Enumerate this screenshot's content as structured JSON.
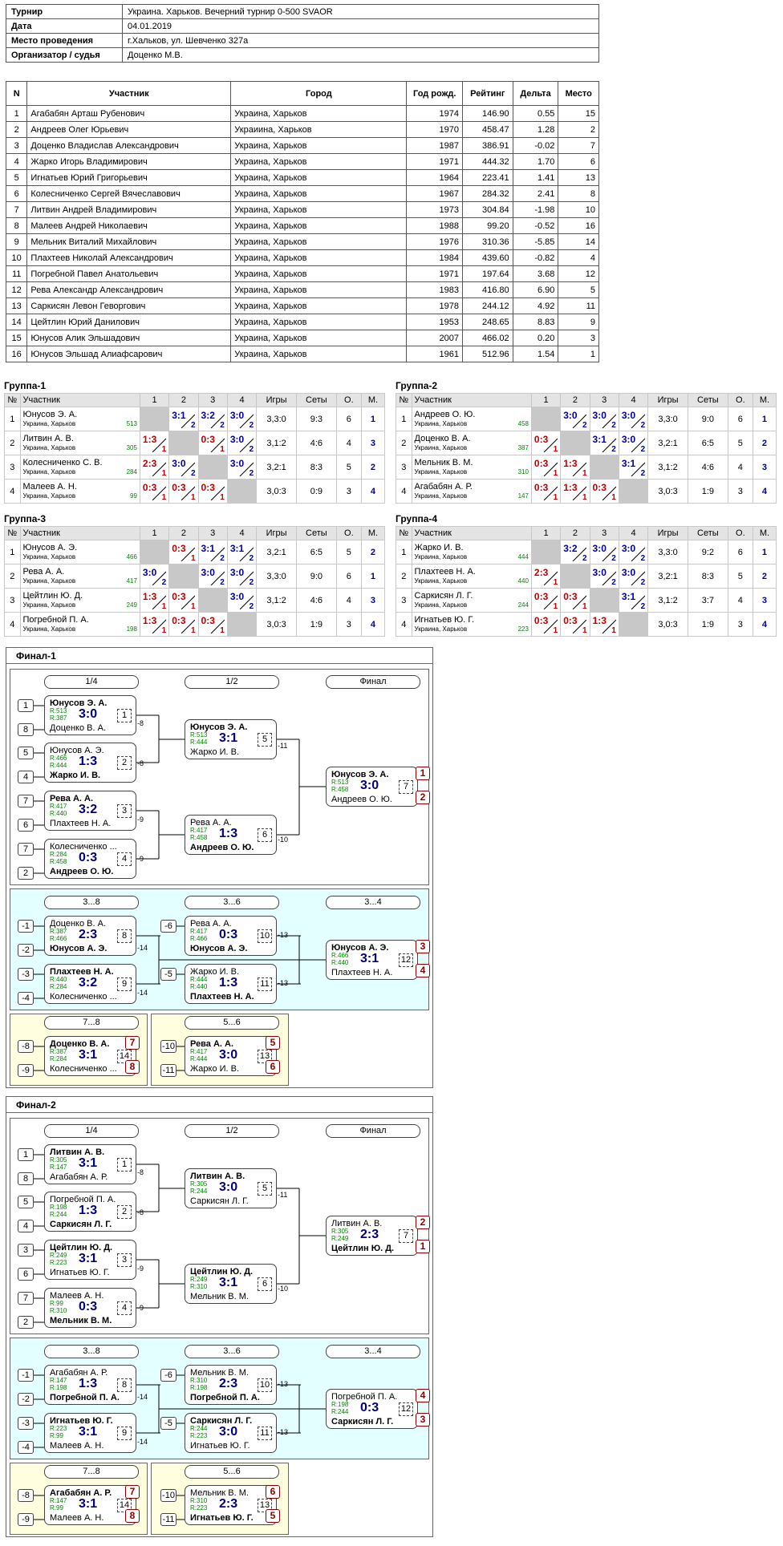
{
  "info": {
    "rows": [
      {
        "k": "Турнир",
        "v": "Украина. Харьков. Вечерний турнир 0-500 SVAOR"
      },
      {
        "k": "Дата",
        "v": "04.01.2019"
      },
      {
        "k": "Место проведения",
        "v": "г.Хальков, ул. Шевченко 327а"
      },
      {
        "k": "Организатор / судья",
        "v": "Доценко М.В."
      }
    ]
  },
  "participants": {
    "headers": [
      "N",
      "Участник",
      "Город",
      "Год рожд.",
      "Рейтинг",
      "Дельта",
      "Место"
    ],
    "rows": [
      [
        "1",
        "Агабабян Арташ Рубенович",
        "Украина, Харьков",
        "1974",
        "146.90",
        "0.55",
        "15"
      ],
      [
        "2",
        "Андреев Олег Юрьевич",
        "Украиина, Харьков",
        "1970",
        "458.47",
        "1.28",
        "2"
      ],
      [
        "3",
        "Доценко Владислав Александрович",
        "Украина, Харьков",
        "1987",
        "386.91",
        "-0.02",
        "7"
      ],
      [
        "4",
        "Жарко Игорь Владимирович",
        "Украина, Харьков",
        "1971",
        "444.32",
        "1.70",
        "6"
      ],
      [
        "5",
        "Игнатьев Юрий Григорьевич",
        "Украина, Харьков",
        "1964",
        "223.41",
        "1.41",
        "13"
      ],
      [
        "6",
        "Колесниченко Сергей Вячеславович",
        "Украина, Харьков",
        "1967",
        "284.32",
        "2.41",
        "8"
      ],
      [
        "7",
        "Литвин Андрей Владимирович",
        "Украина, Харьков",
        "1973",
        "304.84",
        "-1.98",
        "10"
      ],
      [
        "8",
        "Малеев Андрей Николаевич",
        "Украина, Харьков",
        "1988",
        "99.20",
        "-0.52",
        "16"
      ],
      [
        "9",
        "Мельник Виталий Михайлович",
        "Украина, Харьков",
        "1976",
        "310.36",
        "-5.85",
        "14"
      ],
      [
        "10",
        "Плахтеев Николай Александрович",
        "Украина, Харьков",
        "1984",
        "439.60",
        "-0.82",
        "4"
      ],
      [
        "11",
        "Погребной Павел Анатольевич",
        "Украина, Харьков",
        "1971",
        "197.64",
        "3.68",
        "12"
      ],
      [
        "12",
        "Рева Александр Александрович",
        "Украина, Харьков",
        "1983",
        "416.80",
        "6.90",
        "5"
      ],
      [
        "13",
        "Саркисян Левон Геворгович",
        "Украина, Харьков",
        "1978",
        "244.12",
        "4.92",
        "11"
      ],
      [
        "14",
        "Цейтлин Юрий Данилович",
        "Украина, Харьков",
        "1953",
        "248.65",
        "8.83",
        "9"
      ],
      [
        "15",
        "Юнусов Алик Эльшадович",
        "Украина, Харьков",
        "2007",
        "466.02",
        "0.20",
        "3"
      ],
      [
        "16",
        "Юнусов Эльшад Алиафсарович",
        "Украина, Харьков",
        "1961",
        "512.96",
        "1.54",
        "1"
      ]
    ]
  },
  "groups": [
    {
      "title": "Группа-1",
      "headers": [
        "№",
        "Участник",
        "1",
        "2",
        "3",
        "4",
        "Игры",
        "Сеты",
        "О.",
        "М."
      ],
      "rows": [
        {
          "n": "1",
          "name": "Юнусов Э. А.",
          "city": "Украина, Харьков",
          "rating": "513",
          "cells": [
            "",
            "3:1|2",
            "3:2|2",
            "3:0|2"
          ],
          "games": "3,3:0",
          "sets": "9:3",
          "pts": "6",
          "place": "1"
        },
        {
          "n": "2",
          "name": "Литвин А. В.",
          "city": "Украина, Харьков",
          "rating": "305",
          "cells": [
            "1:3|1",
            "",
            "0:3|1",
            "3:0|2"
          ],
          "games": "3,1:2",
          "sets": "4:6",
          "pts": "4",
          "place": "3"
        },
        {
          "n": "3",
          "name": "Колесниченко С. В.",
          "city": "Украина, Харьков",
          "rating": "284",
          "cells": [
            "2:3|1",
            "3:0|2",
            "",
            "3:0|2"
          ],
          "games": "3,2:1",
          "sets": "8:3",
          "pts": "5",
          "place": "2"
        },
        {
          "n": "4",
          "name": "Малеев А. Н.",
          "city": "Украина, Харьков",
          "rating": "99",
          "cells": [
            "0:3|1",
            "0:3|1",
            "0:3|1",
            ""
          ],
          "games": "3,0:3",
          "sets": "0:9",
          "pts": "3",
          "place": "4"
        }
      ]
    },
    {
      "title": "Группа-2",
      "headers": [
        "№",
        "Участник",
        "1",
        "2",
        "3",
        "4",
        "Игры",
        "Сеты",
        "О.",
        "М."
      ],
      "rows": [
        {
          "n": "1",
          "name": "Андреев О. Ю.",
          "city": "Украина, Харьков",
          "rating": "458",
          "cells": [
            "",
            "3:0|2",
            "3:0|2",
            "3:0|2"
          ],
          "games": "3,3:0",
          "sets": "9:0",
          "pts": "6",
          "place": "1"
        },
        {
          "n": "2",
          "name": "Доценко В. А.",
          "city": "Украина, Харьков",
          "rating": "387",
          "cells": [
            "0:3|1",
            "",
            "3:1|2",
            "3:0|2"
          ],
          "games": "3,2:1",
          "sets": "6:5",
          "pts": "5",
          "place": "2"
        },
        {
          "n": "3",
          "name": "Мельник В. М.",
          "city": "Украина, Харьков",
          "rating": "310",
          "cells": [
            "0:3|1",
            "1:3|1",
            "",
            "3:1|2"
          ],
          "games": "3,1:2",
          "sets": "4:6",
          "pts": "4",
          "place": "3"
        },
        {
          "n": "4",
          "name": "Агабабян А. Р.",
          "city": "Украина, Харьков",
          "rating": "147",
          "cells": [
            "0:3|1",
            "1:3|1",
            "0:3|1",
            ""
          ],
          "games": "3,0:3",
          "sets": "1:9",
          "pts": "3",
          "place": "4"
        }
      ]
    },
    {
      "title": "Группа-3",
      "headers": [
        "№",
        "Участник",
        "1",
        "2",
        "3",
        "4",
        "Игры",
        "Сеты",
        "О.",
        "М."
      ],
      "rows": [
        {
          "n": "1",
          "name": "Юнусов А. Э.",
          "city": "Украина, Харьков",
          "rating": "466",
          "cells": [
            "",
            "0:3|1",
            "3:1|2",
            "3:1|2"
          ],
          "games": "3,2:1",
          "sets": "6:5",
          "pts": "5",
          "place": "2"
        },
        {
          "n": "2",
          "name": "Рева А. А.",
          "city": "Украина, Харьков",
          "rating": "417",
          "cells": [
            "3:0|2",
            "",
            "3:0|2",
            "3:0|2"
          ],
          "games": "3,3:0",
          "sets": "9:0",
          "pts": "6",
          "place": "1"
        },
        {
          "n": "3",
          "name": "Цейтлин Ю. Д.",
          "city": "Украина, Харьков",
          "rating": "249",
          "cells": [
            "1:3|1",
            "0:3|1",
            "",
            "3:0|2"
          ],
          "games": "3,1:2",
          "sets": "4:6",
          "pts": "4",
          "place": "3"
        },
        {
          "n": "4",
          "name": "Погребной П. А.",
          "city": "Украина, Харьков",
          "rating": "198",
          "cells": [
            "1:3|1",
            "0:3|1",
            "0:3|1",
            ""
          ],
          "games": "3,0:3",
          "sets": "1:9",
          "pts": "3",
          "place": "4"
        }
      ]
    },
    {
      "title": "Группа-4",
      "headers": [
        "№",
        "Участник",
        "1",
        "2",
        "3",
        "4",
        "Игры",
        "Сеты",
        "О.",
        "М."
      ],
      "rows": [
        {
          "n": "1",
          "name": "Жарко И. В.",
          "city": "Украина, Харьков",
          "rating": "444",
          "cells": [
            "",
            "3:2|2",
            "3:0|2",
            "3:0|2"
          ],
          "games": "3,3:0",
          "sets": "9:2",
          "pts": "6",
          "place": "1"
        },
        {
          "n": "2",
          "name": "Плахтеев Н. А.",
          "city": "Украина, Харьков",
          "rating": "440",
          "cells": [
            "2:3|1",
            "",
            "3:0|2",
            "3:0|2"
          ],
          "games": "3,2:1",
          "sets": "8:3",
          "pts": "5",
          "place": "2"
        },
        {
          "n": "3",
          "name": "Саркисян Л. Г.",
          "city": "Украина, Харьков",
          "rating": "244",
          "cells": [
            "0:3|1",
            "0:3|1",
            "",
            "3:1|2"
          ],
          "games": "3,1:2",
          "sets": "3:7",
          "pts": "4",
          "place": "3"
        },
        {
          "n": "4",
          "name": "Игнатьев Ю. Г.",
          "city": "Украина, Харьков",
          "rating": "223",
          "cells": [
            "0:3|1",
            "0:3|1",
            "1:3|1",
            ""
          ],
          "games": "3,0:3",
          "sets": "1:9",
          "pts": "3",
          "place": "4"
        }
      ]
    }
  ],
  "finals": [
    {
      "title": "Финал-1",
      "rounds": [
        "1/4",
        "1/2",
        "Финал",
        "3...8",
        "3...6",
        "3...4",
        "7...8",
        "5...6"
      ],
      "matches": [
        {
          "p1": "Юнусов Э. А.",
          "r1": "R:513",
          "p2": "Доценко В. А.",
          "r2": "R:387",
          "score": "3:0",
          "no": "1",
          "win": 1,
          "lose": "-8"
        },
        {
          "p1": "Юнусов А. Э.",
          "r1": "R:466",
          "p2": "Жарко И. В.",
          "r2": "R:444",
          "score": "1:3",
          "no": "2",
          "win": 2,
          "lose": "-8"
        },
        {
          "p1": "Рева А. А.",
          "r1": "R:417",
          "p2": "Плахтеев Н. А.",
          "r2": "R:440",
          "score": "3:2",
          "no": "3",
          "win": 1,
          "lose": "-9"
        },
        {
          "p1": "Колесниченко ...",
          "r1": "R:284",
          "p2": "Андреев О. Ю.",
          "r2": "R:458",
          "score": "0:3",
          "no": "4",
          "win": 2,
          "lose": "-9"
        },
        {
          "p1": "Юнусов Э. А.",
          "r1": "R:513",
          "p2": "Жарко И. В.",
          "r2": "R:444",
          "score": "3:1",
          "no": "5",
          "win": 1,
          "lose": "-11"
        },
        {
          "p1": "Рева А. А.",
          "r1": "R:417",
          "p2": "Андреев О. Ю.",
          "r2": "R:458",
          "score": "1:3",
          "no": "6",
          "win": 2,
          "lose": "-10"
        },
        {
          "p1": "Юнусов Э. А.",
          "r1": "R:513",
          "p2": "Андреев О. Ю.",
          "r2": "R:458",
          "score": "3:0",
          "no": "7",
          "win": 1,
          "lose": ""
        },
        {
          "p1": "Доценко В. А.",
          "r1": "R:387",
          "p2": "Юнусов А. Э.",
          "r2": "R:466",
          "score": "2:3",
          "no": "8",
          "win": 2,
          "lose": "-14"
        },
        {
          "p1": "Плахтеев Н. А.",
          "r1": "R:440",
          "p2": "Колесниченко ...",
          "r2": "R:284",
          "score": "3:2",
          "no": "9",
          "win": 1,
          "lose": "-14"
        },
        {
          "p1": "Рева А. А.",
          "r1": "R:417",
          "p2": "Юнусов А. Э.",
          "r2": "R:466",
          "score": "0:3",
          "no": "10",
          "win": 2,
          "lose": "-13"
        },
        {
          "p1": "Жарко И. В.",
          "r1": "R:444",
          "p2": "Плахтеев Н. А.",
          "r2": "R:440",
          "score": "1:3",
          "no": "11",
          "win": 2,
          "lose": "-13"
        },
        {
          "p1": "Юнусов А. Э.",
          "r1": "R:466",
          "p2": "Плахтеев Н. А.",
          "r2": "R:440",
          "score": "3:1",
          "no": "12",
          "win": 1,
          "lose": ""
        },
        {
          "p1": "Доценко В. А.",
          "r1": "R:387",
          "p2": "Колесниченко ...",
          "r2": "R:284",
          "score": "3:1",
          "no": "14",
          "win": 1,
          "lose": ""
        },
        {
          "p1": "Рева А. А.",
          "r1": "R:417",
          "p2": "Жарко И. В.",
          "r2": "R:444",
          "score": "3:0",
          "no": "13",
          "win": 1,
          "lose": ""
        }
      ],
      "seeds": [
        "1",
        "8",
        "5",
        "4",
        "7",
        "6",
        "7",
        "2",
        "-1",
        "-2",
        "-3",
        "-4",
        "-6",
        "-5",
        "-8",
        "-9",
        "-10",
        "-11"
      ],
      "places": [
        "1",
        "2",
        "3",
        "4",
        "7",
        "8",
        "5",
        "6"
      ]
    },
    {
      "title": "Финал-2",
      "rounds": [
        "1/4",
        "1/2",
        "Финал",
        "3...8",
        "3...6",
        "3...4",
        "7...8",
        "5...6"
      ],
      "matches": [
        {
          "p1": "Литвин А. В.",
          "r1": "R:305",
          "p2": "Агабабян А. Р.",
          "r2": "R:147",
          "score": "3:1",
          "no": "1",
          "win": 1,
          "lose": "-8"
        },
        {
          "p1": "Погребной П. А.",
          "r1": "R:198",
          "p2": "Саркисян Л. Г.",
          "r2": "R:244",
          "score": "1:3",
          "no": "2",
          "win": 2,
          "lose": "-8"
        },
        {
          "p1": "Цейтлин Ю. Д.",
          "r1": "R:249",
          "p2": "Игнатьев Ю. Г.",
          "r2": "R:223",
          "score": "3:1",
          "no": "3",
          "win": 1,
          "lose": "-9"
        },
        {
          "p1": "Малеев А. Н.",
          "r1": "R:99",
          "p2": "Мельник В. М.",
          "r2": "R:310",
          "score": "0:3",
          "no": "4",
          "win": 2,
          "lose": "-9"
        },
        {
          "p1": "Литвин А. В.",
          "r1": "R:305",
          "p2": "Саркисян Л. Г.",
          "r2": "R:244",
          "score": "3:0",
          "no": "5",
          "win": 1,
          "lose": "-11"
        },
        {
          "p1": "Цейтлин Ю. Д.",
          "r1": "R:249",
          "p2": "Мельник В. М.",
          "r2": "R:310",
          "score": "3:1",
          "no": "6",
          "win": 1,
          "lose": "-10"
        },
        {
          "p1": "Литвин А. В.",
          "r1": "R:305",
          "p2": "Цейтлин Ю. Д.",
          "r2": "R:249",
          "score": "2:3",
          "no": "7",
          "win": 2,
          "lose": ""
        },
        {
          "p1": "Агабабян А. Р.",
          "r1": "R:147",
          "p2": "Погребной П. А.",
          "r2": "R:198",
          "score": "1:3",
          "no": "8",
          "win": 2,
          "lose": "-14"
        },
        {
          "p1": "Игнатьев Ю. Г.",
          "r1": "R:223",
          "p2": "Малеев А. Н.",
          "r2": "R:99",
          "score": "3:1",
          "no": "9",
          "win": 1,
          "lose": "-14"
        },
        {
          "p1": "Мельник В. М.",
          "r1": "R:310",
          "p2": "Погребной П. А.",
          "r2": "R:198",
          "score": "2:3",
          "no": "10",
          "win": 2,
          "lose": "-13"
        },
        {
          "p1": "Саркисян Л. Г.",
          "r1": "R:244",
          "p2": "Игнатьев Ю. Г.",
          "r2": "R:223",
          "score": "3:0",
          "no": "11",
          "win": 1,
          "lose": "-13"
        },
        {
          "p1": "Погребной П. А.",
          "r1": "R:198",
          "p2": "Саркисян Л. Г.",
          "r2": "R:244",
          "score": "0:3",
          "no": "12",
          "win": 2,
          "lose": ""
        },
        {
          "p1": "Агабабян А. Р.",
          "r1": "R:147",
          "p2": "Малеев А. Н.",
          "r2": "R:99",
          "score": "3:1",
          "no": "14",
          "win": 1,
          "lose": ""
        },
        {
          "p1": "Мельник В. М.",
          "r1": "R:310",
          "p2": "Игнатьев Ю. Г.",
          "r2": "R:223",
          "score": "2:3",
          "no": "13",
          "win": 2,
          "lose": ""
        }
      ],
      "seeds": [
        "1",
        "8",
        "5",
        "4",
        "3",
        "6",
        "7",
        "2",
        "-1",
        "-2",
        "-3",
        "-4",
        "-6",
        "-5",
        "-8",
        "-9",
        "-10",
        "-11"
      ],
      "places": [
        "2",
        "1",
        "4",
        "3",
        "7",
        "8",
        "6",
        "5"
      ]
    }
  ]
}
